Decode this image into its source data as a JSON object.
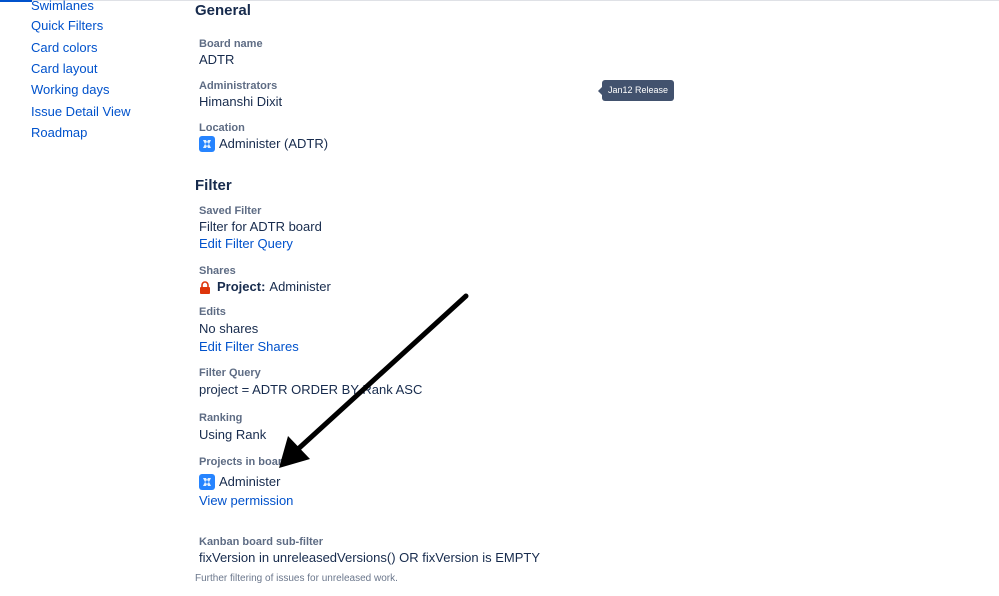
{
  "sidebar": {
    "items": [
      {
        "label": "Swimlanes"
      },
      {
        "label": "Quick Filters"
      },
      {
        "label": "Card colors"
      },
      {
        "label": "Card layout"
      },
      {
        "label": "Working days"
      },
      {
        "label": "Issue Detail View"
      },
      {
        "label": "Roadmap"
      }
    ]
  },
  "general": {
    "title": "General",
    "board_name_label": "Board name",
    "board_name": "ADTR",
    "administrators_label": "Administrators",
    "administrators": "Himanshi Dixit",
    "location_label": "Location",
    "location": "Administer (ADTR)"
  },
  "tooltip": {
    "text": "Jan12 Release"
  },
  "filter": {
    "title": "Filter",
    "saved_filter_label": "Saved Filter",
    "saved_filter": "Filter for ADTR board",
    "edit_filter_query": "Edit Filter Query",
    "shares_label": "Shares",
    "shares_prefix": "Project:",
    "shares_value": "Administer",
    "edits_label": "Edits",
    "edits_value": "No shares",
    "edit_filter_shares": "Edit Filter Shares",
    "filter_query_label": "Filter Query",
    "filter_query": "project = ADTR ORDER BY Rank ASC",
    "ranking_label": "Ranking",
    "ranking": "Using Rank",
    "projects_label": "Projects in board",
    "project": "Administer",
    "view_permission": "View permission",
    "subfilter_label": "Kanban board sub-filter",
    "subfilter": "fixVersion in unreleasedVersions() OR fixVersion is EMPTY",
    "subfilter_desc": "Further filtering of issues for unreleased work."
  },
  "icons": {
    "project": "project-avatar-icon",
    "lock": "lock-icon",
    "arrow": "annotation-arrow"
  },
  "colors": {
    "link": "#0052cc",
    "text": "#172b4d",
    "label": "#5e6c84",
    "tooltip_bg": "#42526e",
    "lock": "#de350b",
    "avatar": "#2684ff"
  }
}
